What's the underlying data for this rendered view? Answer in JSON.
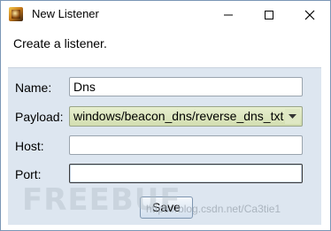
{
  "window": {
    "title": "New Listener",
    "minimize_icon": "minimize-icon",
    "maximize_icon": "maximize-icon",
    "close_icon": "close-icon"
  },
  "header": {
    "text": "Create a listener."
  },
  "form": {
    "name": {
      "label": "Name:",
      "value": "Dns"
    },
    "payload": {
      "label": "Payload:",
      "value": "windows/beacon_dns/reverse_dns_txt"
    },
    "host": {
      "label": "Host:",
      "value": ""
    },
    "port": {
      "label": "Port:",
      "value": ""
    }
  },
  "actions": {
    "save_label": "Save"
  },
  "watermark": {
    "logo": "FREEBUF",
    "url": "https://blog.csdn.net/Ca3tie1"
  },
  "colors": {
    "dialog_bg": "#dde6f0",
    "payload_bg": "#d3deb1",
    "border": "#7a96b5"
  }
}
